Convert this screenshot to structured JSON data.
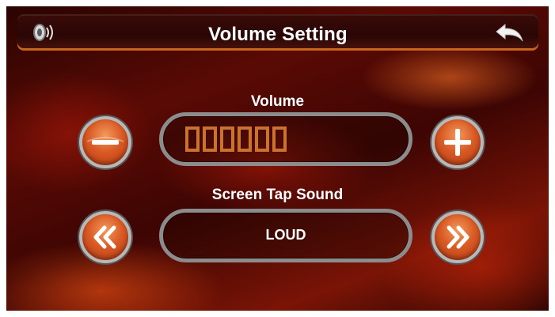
{
  "header": {
    "title": "Volume Setting",
    "left_icon": "speaker-icon",
    "right_icon": "back-arrow-icon"
  },
  "volume": {
    "label": "Volume",
    "decrease_icon": "minus-icon",
    "increase_icon": "plus-icon",
    "segments_total": 6,
    "segments_filled": 0
  },
  "tap_sound": {
    "label": "Screen Tap Sound",
    "value": "LOUD",
    "prev_icon": "double-chevron-left-icon",
    "next_icon": "double-chevron-right-icon"
  },
  "colors": {
    "accent_orange": "#d95a24",
    "segment_outline": "#c9732e",
    "pill_border": "#8c8c8c"
  }
}
